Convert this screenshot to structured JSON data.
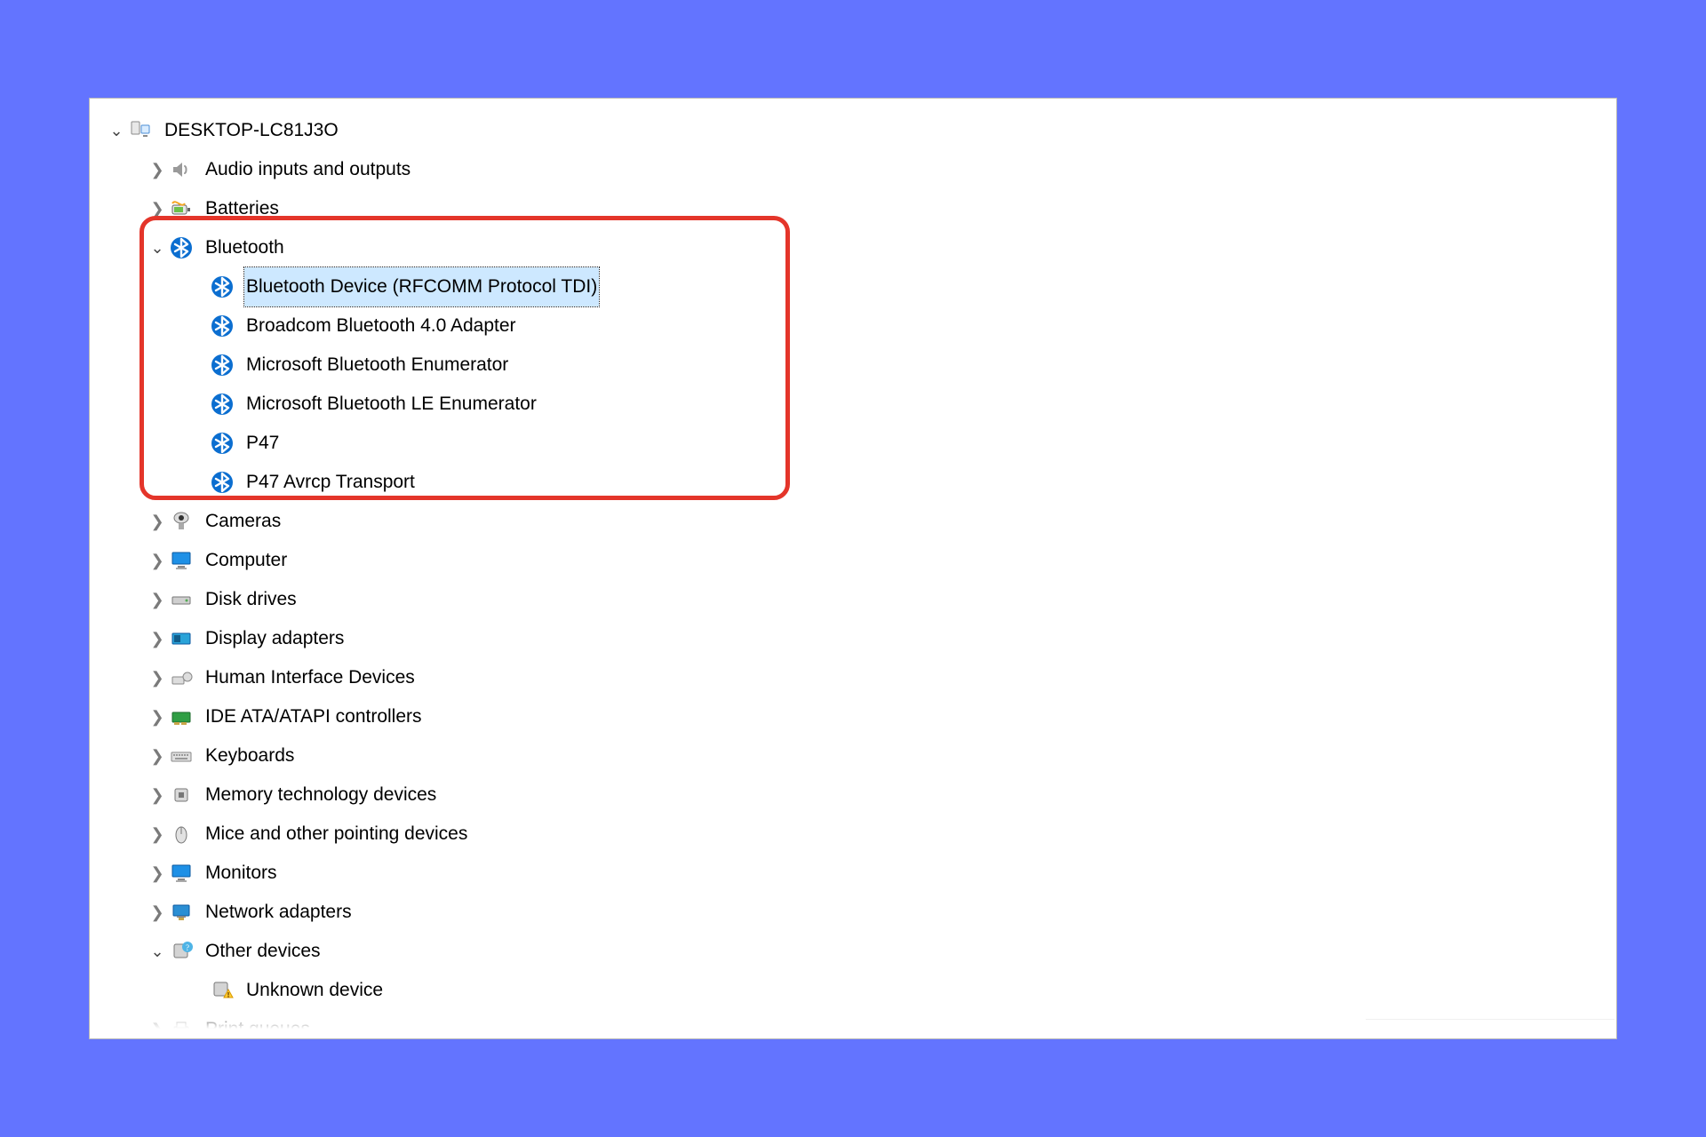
{
  "root": {
    "label": "DESKTOP-LC81J3O"
  },
  "categories": {
    "audio": {
      "label": "Audio inputs and outputs"
    },
    "batteries": {
      "label": "Batteries"
    },
    "bluetooth": {
      "label": "Bluetooth"
    },
    "cameras": {
      "label": "Cameras"
    },
    "computer": {
      "label": "Computer"
    },
    "disk": {
      "label": "Disk drives"
    },
    "display": {
      "label": "Display adapters"
    },
    "hid": {
      "label": "Human Interface Devices"
    },
    "ide": {
      "label": "IDE ATA/ATAPI controllers"
    },
    "keyboards": {
      "label": "Keyboards"
    },
    "memtech": {
      "label": "Memory technology devices"
    },
    "mice": {
      "label": "Mice and other pointing devices"
    },
    "monitors": {
      "label": "Monitors"
    },
    "network": {
      "label": "Network adapters"
    },
    "other": {
      "label": "Other devices"
    },
    "print": {
      "label": "Print queues"
    }
  },
  "bt_children": {
    "c0": {
      "label": "Bluetooth Device (RFCOMM Protocol TDI)"
    },
    "c1": {
      "label": "Broadcom Bluetooth 4.0 Adapter"
    },
    "c2": {
      "label": "Microsoft Bluetooth Enumerator"
    },
    "c3": {
      "label": "Microsoft Bluetooth LE Enumerator"
    },
    "c4": {
      "label": "P47"
    },
    "c5": {
      "label": "P47 Avrcp Transport"
    }
  },
  "other_children": {
    "c0": {
      "label": "Unknown device"
    }
  }
}
